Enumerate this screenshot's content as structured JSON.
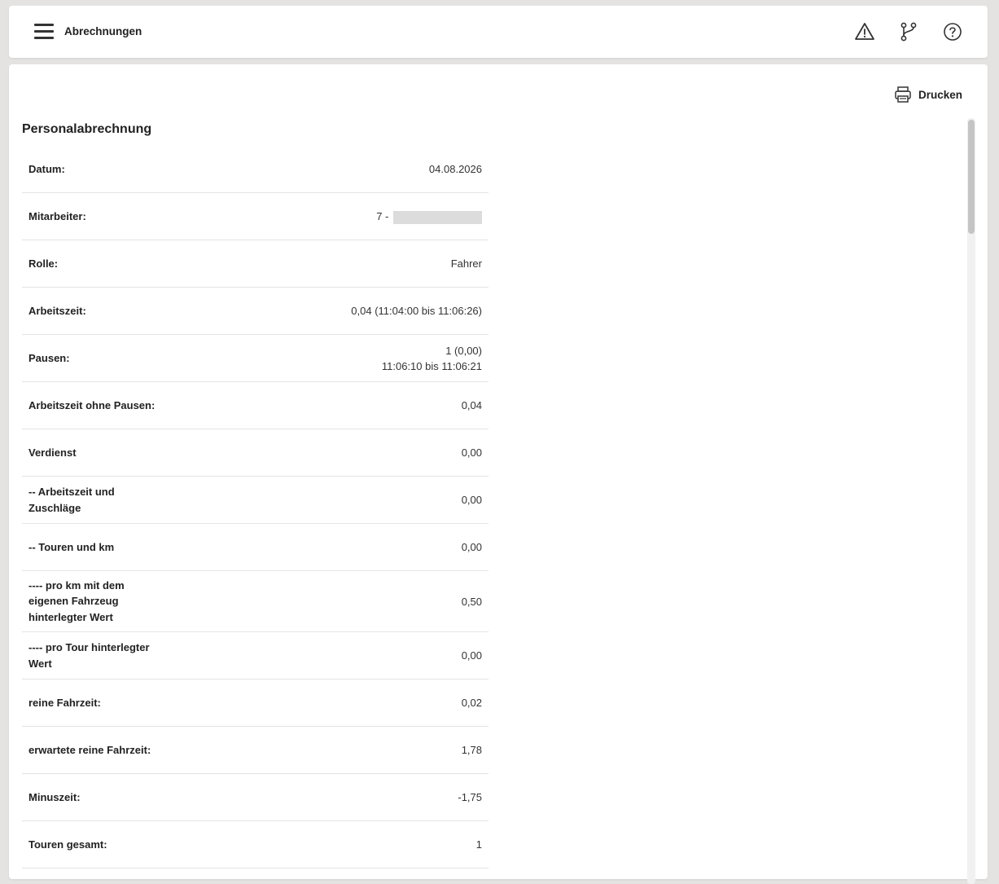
{
  "header": {
    "title": "Abrechnungen",
    "icons": [
      "menu-icon",
      "warning-icon",
      "branch-icon",
      "help-icon"
    ]
  },
  "toolbar": {
    "print_label": "Drucken"
  },
  "section": {
    "title": "Personalabrechnung"
  },
  "rows": [
    {
      "label": "Datum:",
      "value": "04.08.2026"
    },
    {
      "label": "Mitarbeiter:",
      "value": "7 -"
    },
    {
      "label": "Rolle:",
      "value": "Fahrer"
    },
    {
      "label": "Arbeitszeit:",
      "value": "0,04 (11:04:00 bis 11:06:26)"
    },
    {
      "label": "Pausen:",
      "value": "1 (0,00)",
      "value2": "11:06:10 bis 11:06:21"
    },
    {
      "label": "Arbeitszeit ohne Pausen:",
      "value": "0,04"
    },
    {
      "label": "Verdienst",
      "value": "0,00"
    },
    {
      "label": "-- Arbeitszeit und Zuschläge",
      "value": "0,00"
    },
    {
      "label": "-- Touren und km",
      "value": "0,00"
    },
    {
      "label": "---- pro km mit dem eigenen Fahrzeug hinterlegter Wert",
      "value": "0,50"
    },
    {
      "label": "---- pro Tour hinterlegter Wert",
      "value": "0,00"
    },
    {
      "label": "reine Fahrzeit:",
      "value": "0,02"
    },
    {
      "label": "erwartete reine Fahrzeit:",
      "value": "1,78"
    },
    {
      "label": "Minuszeit:",
      "value": "-1,75"
    },
    {
      "label": "Touren gesamt:",
      "value": "1"
    }
  ]
}
